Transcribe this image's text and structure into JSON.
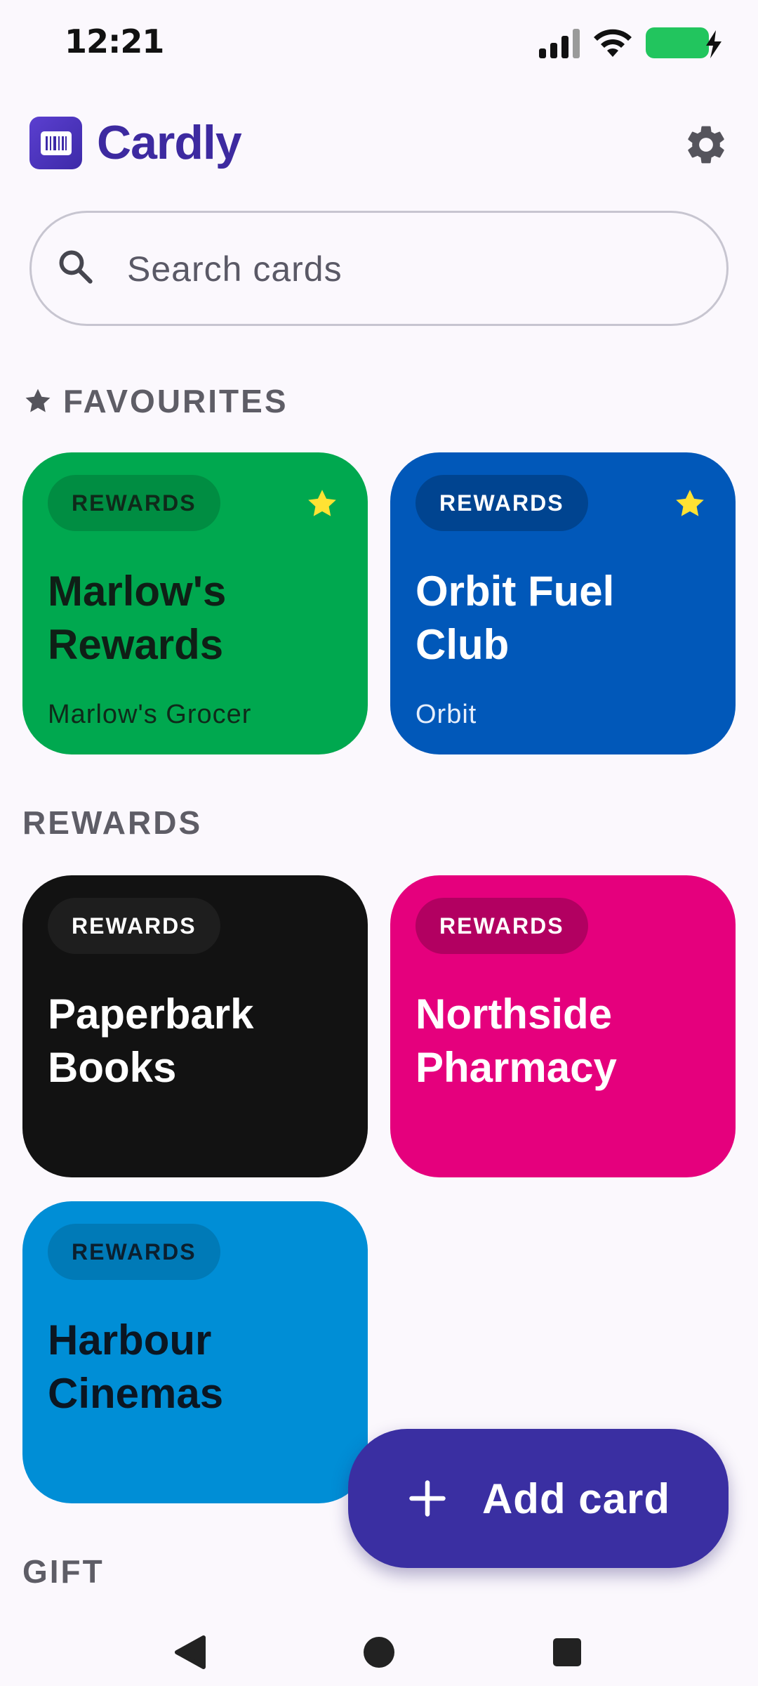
{
  "status": {
    "time": "12:21"
  },
  "app": {
    "title": "Cardly"
  },
  "search": {
    "placeholder": "Search cards"
  },
  "sections": {
    "favourites": "FAVOURITES",
    "rewards": "REWARDS",
    "gift": "GIFT"
  },
  "favourites": [
    {
      "badge": "REWARDS",
      "name": "Marlow's Rewards",
      "subtitle": "Marlow's Grocer",
      "color": "#00a84f",
      "starred": true
    },
    {
      "badge": "REWARDS",
      "name": "Orbit Fuel Club",
      "subtitle": "Orbit",
      "color": "#0158b9",
      "starred": true
    }
  ],
  "rewards": [
    {
      "badge": "REWARDS",
      "name": "Paperbark Books",
      "color": "#121212"
    },
    {
      "badge": "REWARDS",
      "name": "Northside Pharmacy",
      "color": "#e5007d"
    },
    {
      "badge": "REWARDS",
      "name": "Harbour Cinemas",
      "color": "#008ed6"
    }
  ],
  "fab": {
    "label": "Add card"
  },
  "colors": {
    "accent": "#3a2fa2",
    "star": "#ffe233"
  }
}
